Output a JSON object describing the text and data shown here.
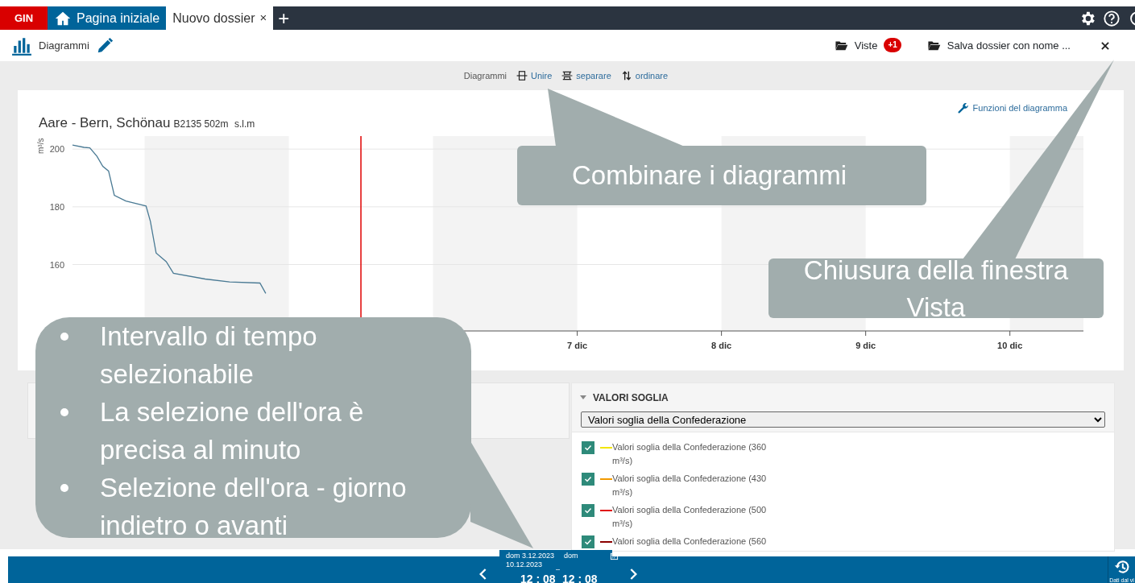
{
  "tabs": [
    {
      "label": "GIN",
      "kind": "brand",
      "selected": false
    },
    {
      "label": "Pagina iniziale",
      "kind": "home",
      "selected": false
    },
    {
      "label": "Nuovo dossier",
      "kind": "doc",
      "selected": true,
      "close": "×"
    }
  ],
  "add_tab": "+",
  "toolbar": {
    "title": "Diagrammi",
    "views": {
      "label": "Viste",
      "badge": "+1"
    },
    "save": "Salva dossier con nome ..."
  },
  "diagram_bar": {
    "label": "Diagrammi",
    "actions": [
      {
        "label": "Unire",
        "kind": "merge"
      },
      {
        "label": "separare",
        "kind": "split"
      },
      {
        "label": "ordinare",
        "kind": "sort"
      }
    ]
  },
  "chart_card": {
    "title": "Aare - Bern, Schönau",
    "station": "B2135 502m",
    "altitude": "s.l.m",
    "functions": "Funzioni del diagramma",
    "chart_data": {
      "type": "line",
      "ylabel": "m³/s",
      "xlim": [
        3.5,
        10.51
      ],
      "ylim": [
        137,
        204.5
      ],
      "yticks": [
        160,
        180,
        200
      ],
      "xticks": [
        {
          "value": 7,
          "label": "7 dic"
        },
        {
          "value": 8,
          "label": "8 dic"
        },
        {
          "value": 9,
          "label": "9 dic"
        },
        {
          "value": 10,
          "label": "10 dic"
        }
      ],
      "grid": true,
      "ref_lines": [
        {
          "axis": "x",
          "value": 5.5,
          "color": "#e00000"
        }
      ],
      "bands": [
        {
          "axis": "x",
          "from": 4,
          "to": 5,
          "color": "#f3f3f3"
        },
        {
          "axis": "x",
          "from": 6,
          "to": 7,
          "color": "#f3f3f3"
        },
        {
          "axis": "x",
          "from": 8,
          "to": 9,
          "color": "#f3f3f3"
        },
        {
          "axis": "x",
          "from": 10,
          "to": 10.51,
          "color": "#f3f3f3"
        }
      ],
      "x": [
        3.5,
        3.58,
        3.62,
        3.67,
        3.71,
        3.75,
        3.79,
        3.87,
        4.01,
        4.04,
        4.08,
        4.15,
        4.2,
        4.42,
        4.59,
        4.8,
        4.84
      ],
      "series": [
        {
          "color": "#4a7a94",
          "values": [
            201.4,
            200.6,
            200.4,
            197.5,
            194,
            192.4,
            184,
            182,
            180.3,
            175,
            164,
            161,
            157,
            155,
            154,
            153.6,
            150
          ]
        }
      ]
    }
  },
  "thresholds": {
    "title": "VALORI SOGLIA",
    "select": "Valori soglia della Confederazione",
    "items": [
      {
        "label": "Valori soglia della Confederazione (360",
        "unit": "m³/s)",
        "color": "#f2e600",
        "checked": true
      },
      {
        "label": "Valori soglia della Confederazione (430",
        "unit": "m³/s)",
        "color": "#f29a00",
        "checked": true
      },
      {
        "label": "Valori soglia della Confederazione (500",
        "unit": "m³/s)",
        "color": "#e01010",
        "checked": true
      },
      {
        "label": "Valori soglia della Confederazione (560",
        "color": "#8a0000",
        "checked": true
      }
    ]
  },
  "time_bar": {
    "from_date": "dom 3.12.2023",
    "to_day": "dom",
    "to_date": "10.12.2023",
    "dash": "–",
    "from_time": "12 : 08",
    "to_time": "12 : 08",
    "history": "Dati dal vi"
  },
  "callouts": [
    {
      "text": "Combinare i diagrammi",
      "kind": "plain"
    },
    {
      "text": "Chiusura della finestra Vista",
      "kind": "plain"
    },
    {
      "kind": "bullets",
      "items": [
        "Intervallo di tempo selezionabile",
        "La selezione dell'ora è precisa al minuto",
        "Selezione dell'ora - giorno indietro o avanti"
      ]
    }
  ]
}
